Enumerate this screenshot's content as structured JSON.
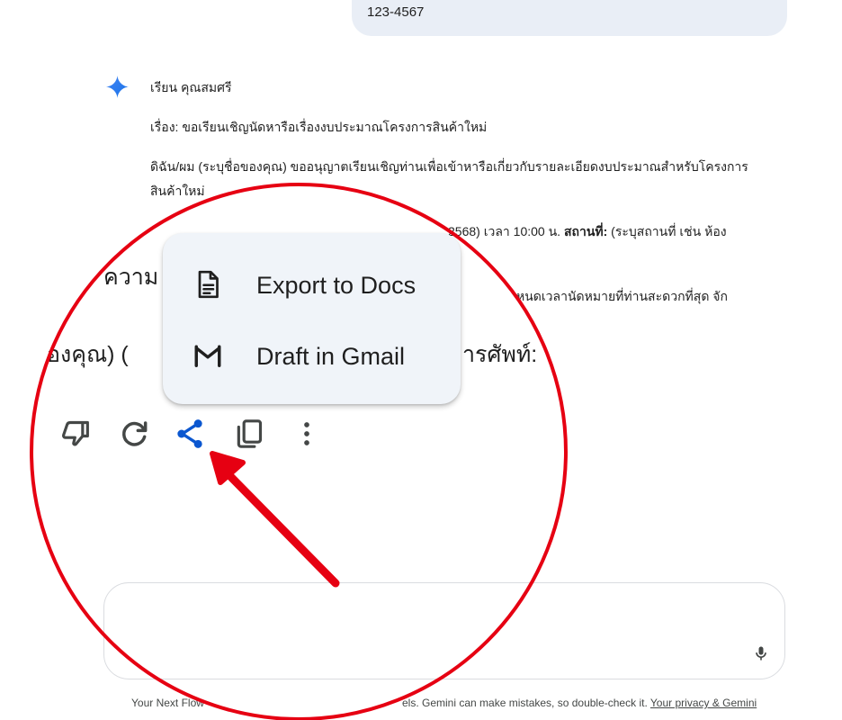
{
  "user_message": {
    "text": "123-4567"
  },
  "response": {
    "greeting": "เรียน คุณสมศรี",
    "subject": "เรื่อง: ขอเรียนเชิญนัดหารือเรื่องงบประมาณโครงการสินค้าใหม่",
    "body_line1": "ดิฉัน/ผม (ระบุชื่อของคุณ) ขออนุญาตเรียนเชิญท่านเพื่อเข้าหารือเกี่ยวกับรายละเอียดงบประมาณสำหรับโครงการ",
    "body_line2": "สินค้าใหม่",
    "schedule_partial": "2568) เวลา 10:00 น. ",
    "location_label": "สถานที่:",
    "location_text": " (ระบุสถานที่ เช่น ห้อง",
    "closing_partial": "หนดเวลานัดหมายที่ท่านสะดวกที่สุด จัก",
    "zoom_line1_partial": "ความ",
    "zoom_line2_left": "องคุณ) (",
    "zoom_line2_right": "ารศัพท์:"
  },
  "share_menu": {
    "items": [
      {
        "label": "Export to Docs",
        "icon": "docs-icon"
      },
      {
        "label": "Draft in Gmail",
        "icon": "gmail-icon"
      }
    ]
  },
  "toolbar": {
    "buttons": [
      "thumbs-down-icon",
      "regenerate-icon",
      "share-icon",
      "copy-icon",
      "more-vert-icon"
    ]
  },
  "input": {
    "placeholder": ""
  },
  "footer": {
    "left_partial": "Your Next Flow",
    "middle_partial": "els. Gemini can make mistakes, so double-check it. ",
    "privacy_link": "Your privacy & Gemini"
  },
  "colors": {
    "annotation_red": "#e60012",
    "share_blue": "#0b57d0",
    "popup_bg": "#f0f4f9",
    "bubble_bg": "#e9eef6"
  }
}
